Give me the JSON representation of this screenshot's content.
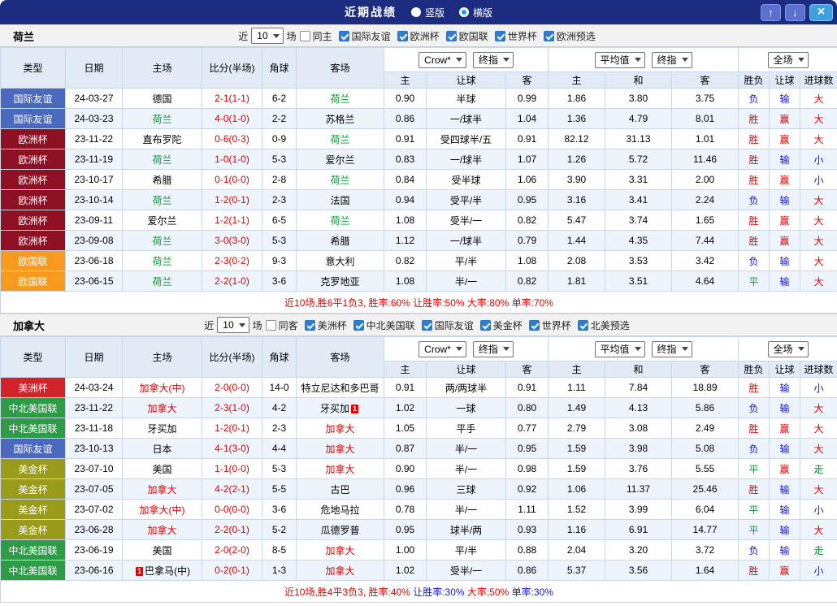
{
  "titlebar": {
    "title": "近期战绩",
    "radios": [
      {
        "label": "竖版",
        "selected": false
      },
      {
        "label": "横版",
        "selected": true
      }
    ],
    "buttons": {
      "up": "↑",
      "down": "↓",
      "close": "×"
    }
  },
  "palette": {
    "red": "#e00000",
    "blue": "#1414cc",
    "green": "#009933",
    "dark": "#333333"
  },
  "type_colors": {
    "国际友谊": "#4a69bd",
    "欧洲杯": "#8e1023",
    "欧国联": "#f79a1f",
    "美洲杯": "#d2232a",
    "中北美国联": "#2e9b47",
    "美金杯": "#9a9b1a"
  },
  "controls": {
    "near": "近",
    "games": "场",
    "crow": "Crow*",
    "final": "终指",
    "average": "平均值",
    "fulltime": "全场"
  },
  "columns": {
    "main": [
      "类型",
      "日期",
      "主场",
      "比分(半场)",
      "角球",
      "客场"
    ],
    "sub": [
      "主",
      "让球",
      "客",
      "主",
      "和",
      "客",
      "胜负",
      "让球",
      "进球数"
    ]
  },
  "sections": [
    {
      "team": "荷兰",
      "near_value": "10",
      "same_label": "同主",
      "same_checked": false,
      "leagues": [
        {
          "label": "国际友谊",
          "checked": true
        },
        {
          "label": "欧洲杯",
          "checked": true
        },
        {
          "label": "欧国联",
          "checked": true
        },
        {
          "label": "世界杯",
          "checked": true
        },
        {
          "label": "欧洲预选",
          "checked": true
        }
      ],
      "rows": [
        {
          "type": "国际友谊",
          "date": "24-03-27",
          "home": "德国",
          "away": "荷兰",
          "away_color": "green",
          "score": "2-1(1-1)",
          "corners": "6-2",
          "odds": [
            "0.90",
            "半球",
            "0.99"
          ],
          "avg": [
            "1.86",
            "3.80",
            "3.75"
          ],
          "res": [
            [
              "负",
              "blue"
            ],
            [
              "输",
              "blue"
            ],
            [
              "大",
              "red"
            ]
          ]
        },
        {
          "type": "国际友谊",
          "date": "24-03-23",
          "home": "荷兰",
          "home_color": "green",
          "away": "苏格兰",
          "score": "4-0(1-0)",
          "corners": "2-2",
          "odds": [
            "0.86",
            "一/球半",
            "1.04"
          ],
          "avg": [
            "1.36",
            "4.79",
            "8.01"
          ],
          "res": [
            [
              "胜",
              "red"
            ],
            [
              "赢",
              "red"
            ],
            [
              "大",
              "red"
            ]
          ]
        },
        {
          "type": "欧洲杯",
          "date": "23-11-22",
          "home": "直布罗陀",
          "away": "荷兰",
          "away_color": "green",
          "score": "0-6(0-3)",
          "corners": "0-9",
          "odds": [
            "0.91",
            "受四球半/五",
            "0.91"
          ],
          "avg": [
            "82.12",
            "31.13",
            "1.01"
          ],
          "res": [
            [
              "胜",
              "red"
            ],
            [
              "赢",
              "red"
            ],
            [
              "大",
              "red"
            ]
          ]
        },
        {
          "type": "欧洲杯",
          "date": "23-11-19",
          "home": "荷兰",
          "home_color": "green",
          "away": "爱尔兰",
          "score": "1-0(1-0)",
          "corners": "5-3",
          "odds": [
            "0.83",
            "一/球半",
            "1.07"
          ],
          "avg": [
            "1.26",
            "5.72",
            "11.46"
          ],
          "res": [
            [
              "胜",
              "red"
            ],
            [
              "输",
              "blue"
            ],
            [
              "小",
              "blue"
            ]
          ]
        },
        {
          "type": "欧洲杯",
          "date": "23-10-17",
          "home": "希腊",
          "away": "荷兰",
          "away_color": "green",
          "score": "0-1(0-0)",
          "corners": "2-8",
          "odds": [
            "0.84",
            "受半球",
            "1.06"
          ],
          "avg": [
            "3.90",
            "3.31",
            "2.00"
          ],
          "res": [
            [
              "胜",
              "red"
            ],
            [
              "赢",
              "red"
            ],
            [
              "小",
              "blue"
            ]
          ]
        },
        {
          "type": "欧洲杯",
          "date": "23-10-14",
          "home": "荷兰",
          "home_color": "green",
          "away": "法国",
          "score": "1-2(0-1)",
          "corners": "2-3",
          "odds": [
            "0.94",
            "受平/半",
            "0.95"
          ],
          "avg": [
            "3.16",
            "3.41",
            "2.24"
          ],
          "res": [
            [
              "负",
              "blue"
            ],
            [
              "输",
              "blue"
            ],
            [
              "大",
              "red"
            ]
          ]
        },
        {
          "type": "欧洲杯",
          "date": "23-09-11",
          "home": "爱尔兰",
          "away": "荷兰",
          "away_color": "green",
          "score": "1-2(1-1)",
          "corners": "6-5",
          "odds": [
            "1.08",
            "受半/一",
            "0.82"
          ],
          "avg": [
            "5.47",
            "3.74",
            "1.65"
          ],
          "res": [
            [
              "胜",
              "red"
            ],
            [
              "赢",
              "red"
            ],
            [
              "大",
              "red"
            ]
          ]
        },
        {
          "type": "欧洲杯",
          "date": "23-09-08",
          "home": "荷兰",
          "home_color": "green",
          "away": "希腊",
          "score": "3-0(3-0)",
          "corners": "5-3",
          "odds": [
            "1.12",
            "一/球半",
            "0.79"
          ],
          "avg": [
            "1.44",
            "4.35",
            "7.44"
          ],
          "res": [
            [
              "胜",
              "red"
            ],
            [
              "赢",
              "red"
            ],
            [
              "大",
              "red"
            ]
          ]
        },
        {
          "type": "欧国联",
          "date": "23-06-18",
          "home": "荷兰",
          "home_color": "green",
          "away": "意大利",
          "score": "2-3(0-2)",
          "corners": "9-3",
          "odds": [
            "0.82",
            "平/半",
            "1.08"
          ],
          "avg": [
            "2.08",
            "3.53",
            "3.42"
          ],
          "res": [
            [
              "负",
              "blue"
            ],
            [
              "输",
              "blue"
            ],
            [
              "大",
              "red"
            ]
          ]
        },
        {
          "type": "欧国联",
          "date": "23-06-15",
          "home": "荷兰",
          "home_color": "green",
          "away": "克罗地亚",
          "score": "2-2(1-0)",
          "corners": "3-6",
          "odds": [
            "1.08",
            "半/一",
            "0.82"
          ],
          "avg": [
            "1.81",
            "3.51",
            "4.64"
          ],
          "res": [
            [
              "平",
              "green"
            ],
            [
              "输",
              "blue"
            ],
            [
              "大",
              "red"
            ]
          ]
        }
      ],
      "footer": [
        [
          "近10场,胜6平1负3, ",
          "red"
        ],
        [
          "胜率:60%",
          "red"
        ],
        [
          " 让胜率:50%",
          "red"
        ],
        [
          " 大率:80%",
          "red"
        ],
        [
          " 单率:70%",
          "red"
        ]
      ]
    },
    {
      "team": "加拿大",
      "near_value": "10",
      "same_label": "同客",
      "same_checked": false,
      "leagues": [
        {
          "label": "美洲杯",
          "checked": true
        },
        {
          "label": "中北美国联",
          "checked": true
        },
        {
          "label": "国际友谊",
          "checked": true
        },
        {
          "label": "美金杯",
          "checked": true
        },
        {
          "label": "世界杯",
          "checked": true
        },
        {
          "label": "北美预选",
          "checked": true
        }
      ],
      "rows": [
        {
          "type": "美洲杯",
          "date": "24-03-24",
          "home": "加拿大(中)",
          "home_color": "red",
          "away": "特立尼达和多巴哥",
          "score": "2-0(0-0)",
          "corners": "14-0",
          "odds": [
            "0.91",
            "两/两球半",
            "0.91"
          ],
          "avg": [
            "1.11",
            "7.84",
            "18.89"
          ],
          "res": [
            [
              "胜",
              "red"
            ],
            [
              "输",
              "blue"
            ],
            [
              "小",
              "blue"
            ]
          ]
        },
        {
          "type": "中北美国联",
          "date": "23-11-22",
          "home": "加拿大",
          "home_color": "red",
          "away": "牙买加",
          "away_card": "after",
          "score": "2-3(1-0)",
          "corners": "4-2",
          "odds": [
            "1.02",
            "一球",
            "0.80"
          ],
          "avg": [
            "1.49",
            "4.13",
            "5.86"
          ],
          "res": [
            [
              "负",
              "blue"
            ],
            [
              "输",
              "blue"
            ],
            [
              "大",
              "red"
            ]
          ]
        },
        {
          "type": "中北美国联",
          "date": "23-11-18",
          "home": "牙买加",
          "away": "加拿大",
          "away_color": "red",
          "score": "1-2(0-1)",
          "corners": "2-3",
          "odds": [
            "1.05",
            "平手",
            "0.77"
          ],
          "avg": [
            "2.79",
            "3.08",
            "2.49"
          ],
          "res": [
            [
              "胜",
              "red"
            ],
            [
              "赢",
              "red"
            ],
            [
              "大",
              "red"
            ]
          ]
        },
        {
          "type": "国际友谊",
          "date": "23-10-13",
          "home": "日本",
          "away": "加拿大",
          "away_color": "red",
          "score": "4-1(3-0)",
          "corners": "4-4",
          "odds": [
            "0.87",
            "半/一",
            "0.95"
          ],
          "avg": [
            "1.59",
            "3.98",
            "5.08"
          ],
          "res": [
            [
              "负",
              "blue"
            ],
            [
              "输",
              "blue"
            ],
            [
              "大",
              "red"
            ]
          ]
        },
        {
          "type": "美金杯",
          "date": "23-07-10",
          "home": "美国",
          "away": "加拿大",
          "away_color": "red",
          "score": "1-1(0-0)",
          "corners": "5-3",
          "odds": [
            "0.90",
            "半/一",
            "0.98"
          ],
          "avg": [
            "1.59",
            "3.76",
            "5.55"
          ],
          "res": [
            [
              "平",
              "green"
            ],
            [
              "赢",
              "red"
            ],
            [
              "走",
              "green"
            ]
          ]
        },
        {
          "type": "美金杯",
          "date": "23-07-05",
          "home": "加拿大",
          "home_color": "red",
          "away": "古巴",
          "score": "4-2(2-1)",
          "corners": "5-5",
          "odds": [
            "0.96",
            "三球",
            "0.92"
          ],
          "avg": [
            "1.06",
            "11.37",
            "25.46"
          ],
          "res": [
            [
              "胜",
              "red"
            ],
            [
              "输",
              "blue"
            ],
            [
              "大",
              "red"
            ]
          ]
        },
        {
          "type": "美金杯",
          "date": "23-07-02",
          "home": "加拿大(中)",
          "home_color": "red",
          "away": "危地马拉",
          "score": "0-0(0-0)",
          "corners": "3-6",
          "odds": [
            "0.78",
            "半/一",
            "1.11"
          ],
          "avg": [
            "1.52",
            "3.99",
            "6.04"
          ],
          "res": [
            [
              "平",
              "green"
            ],
            [
              "输",
              "blue"
            ],
            [
              "小",
              "blue"
            ]
          ]
        },
        {
          "type": "美金杯",
          "date": "23-06-28",
          "home": "加拿大",
          "home_color": "red",
          "away": "瓜德罗普",
          "score": "2-2(0-1)",
          "corners": "5-2",
          "odds": [
            "0.95",
            "球半/两",
            "0.93"
          ],
          "avg": [
            "1.16",
            "6.91",
            "14.77"
          ],
          "res": [
            [
              "平",
              "green"
            ],
            [
              "输",
              "blue"
            ],
            [
              "大",
              "red"
            ]
          ]
        },
        {
          "type": "中北美国联",
          "date": "23-06-19",
          "home": "美国",
          "away": "加拿大",
          "away_color": "red",
          "score": "2-0(2-0)",
          "corners": "8-5",
          "odds": [
            "1.00",
            "平/半",
            "0.88"
          ],
          "avg": [
            "2.04",
            "3.20",
            "3.72"
          ],
          "res": [
            [
              "负",
              "blue"
            ],
            [
              "输",
              "blue"
            ],
            [
              "走",
              "green"
            ]
          ]
        },
        {
          "type": "中北美国联",
          "date": "23-06-16",
          "home": "巴拿马(中)",
          "home_card": "before",
          "away": "加拿大",
          "away_color": "red",
          "score": "0-2(0-1)",
          "corners": "1-3",
          "odds": [
            "1.02",
            "受半/一",
            "0.86"
          ],
          "avg": [
            "5.37",
            "3.56",
            "1.64"
          ],
          "res": [
            [
              "胜",
              "red"
            ],
            [
              "赢",
              "red"
            ],
            [
              "小",
              "blue"
            ]
          ]
        }
      ],
      "footer": [
        [
          "近10场,胜4平3负3, ",
          "red"
        ],
        [
          "胜率:40%",
          "red"
        ],
        [
          " 让胜率:30%",
          "blue"
        ],
        [
          " 大率:50%",
          "red"
        ],
        [
          " 单率:30%",
          "blue"
        ]
      ]
    }
  ]
}
